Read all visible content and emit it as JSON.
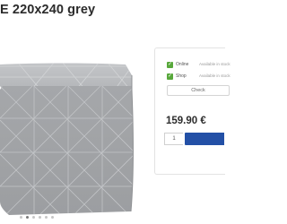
{
  "product": {
    "title": "E 220x240 grey",
    "image_icon": "grey-geometric-quilted-bedspread",
    "gallery_dots": 6,
    "gallery_active_dot": 1
  },
  "availability": [
    {
      "icon": "check-icon",
      "check": "✓",
      "label": "Online",
      "value": "Available in stock"
    },
    {
      "icon": "check-icon",
      "check": "✓",
      "label": "Shop",
      "value": "Available in stock"
    }
  ],
  "options": {
    "label": "Check"
  },
  "purchase": {
    "price": "159.90 €",
    "quantity": "1",
    "add_to_cart_label": ""
  },
  "colors": {
    "accent": "#2350a6",
    "check": "#58a83b",
    "quilt": "#a7a9ac"
  }
}
